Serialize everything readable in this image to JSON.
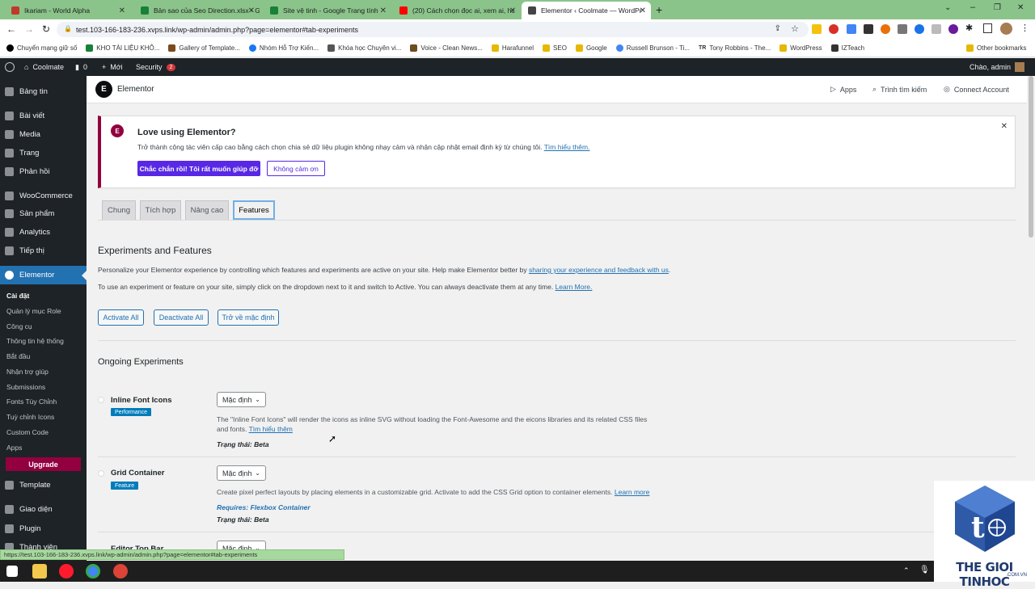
{
  "browser": {
    "tabs": [
      {
        "title": "Ikariam - World Alpha",
        "color": "#c0392b"
      },
      {
        "title": "Bản sao của Seo Direction.xlsx - G",
        "color": "#188038"
      },
      {
        "title": "Site vệ tinh - Google Trang tính",
        "color": "#188038"
      },
      {
        "title": "(20) Cách chọn đọc ai, xem ai, hc",
        "color": "#ff0000"
      },
      {
        "title": "Elementor ‹ Coolmate — WordPr",
        "color": "#444444"
      }
    ],
    "url": "test.103-166-183-236.xvps.link/wp-admin/admin.php?page=elementor#tab-experiments",
    "bookmarks": [
      "Chuyển mạng giữ số",
      "KHO TÀI LIỆU KHÔ...",
      "Gallery of Template...",
      "Nhóm Hỗ Trợ Kiến...",
      "Khóa học Chuyên vi...",
      "Voice - Clean News...",
      "Harafunnel",
      "SEO",
      "Google",
      "Russell Brunson - Ti...",
      "Tony Robbins - The...",
      "WordPress",
      "IZTeach"
    ],
    "other_bookmarks": "Other bookmarks",
    "tr_prefix": "TR"
  },
  "adminbar": {
    "site": "Coolmate",
    "comments": "0",
    "new": "Mới",
    "security": "Security",
    "security_count": "2",
    "greeting": "Chào, admin"
  },
  "sidebar": {
    "menu_top": [
      "Bảng tin",
      "Bài viết",
      "Media",
      "Trang",
      "Phản hồi",
      "WooCommerce",
      "Sản phẩm",
      "Analytics",
      "Tiếp thị"
    ],
    "elementor": "Elementor",
    "subs": [
      "Cài đặt",
      "Quản lý mục Role",
      "Công cụ",
      "Thông tin hệ thống",
      "Bắt đầu",
      "Nhận trợ giúp",
      "Submissions",
      "Fonts Tùy Chỉnh",
      "Tuỳ chỉnh Icons",
      "Custom Code",
      "Apps"
    ],
    "upgrade": "Upgrade",
    "menu_bottom": [
      "Template",
      "Giao diện",
      "Plugin",
      "Thành viên"
    ]
  },
  "elementor_header": {
    "title": "Elementor",
    "apps": "Apps",
    "finder": "Trình tìm kiếm",
    "connect": "Connect Account"
  },
  "notice": {
    "title": "Love using Elementor?",
    "text": "Trở thành cộng tác viên cấp cao bằng cách chọn chia sẻ dữ liệu plugin không nhạy cảm và nhận cập nhật email định kỳ từ chúng tôi.",
    "link": "Tìm hiểu thêm.",
    "accept": "Chắc chắn rồi! Tôi rất muốn giúp đỡ",
    "decline": "Không cảm ơn"
  },
  "tabs": [
    "Chung",
    "Tích hợp",
    "Nâng cao",
    "Features"
  ],
  "experiments": {
    "heading": "Experiments and Features",
    "intro1": "Personalize your Elementor experience by controlling which features and experiments are active on your site. Help make Elementor better by",
    "intro1_link": "sharing your experience and feedback with us",
    "intro2": "To use an experiment or feature on your site, simply click on the dropdown next to it and switch to Active. You can always deactivate them at any time.",
    "intro2_link": "Learn More.",
    "activate_all": "Activate All",
    "deactivate_all": "Deactivate All",
    "reset": "Trở về mặc định",
    "ongoing": "Ongoing Experiments",
    "items": [
      {
        "title": "Inline Font Icons",
        "tag": "Performance",
        "select": "Mặc định",
        "desc": "The \"Inline Font Icons\" will render the icons as inline SVG without loading the Font-Awesome and the eicons libraries and its related CSS files and fonts.",
        "desc_link": "Tìm hiểu thêm",
        "status": "Trạng thái: Beta"
      },
      {
        "title": "Grid Container",
        "tag": "Feature",
        "select": "Mặc định",
        "desc": "Create pixel perfect layouts by placing elements in a customizable grid. Activate to add the CSS Grid option to container elements.",
        "desc_link": "Learn more",
        "requires": "Requires: Flexbox Container",
        "status": "Trạng thái: Beta"
      },
      {
        "title": "Editor Top Bar",
        "select": "Mặc định"
      }
    ]
  },
  "status_url": "https://test.103-166-183-236.xvps.link/wp-admin/admin.php?page=elementor#tab-experiments",
  "watermark": {
    "text": "THE GIOI TINHOC",
    "sub": ".COM.VN"
  }
}
